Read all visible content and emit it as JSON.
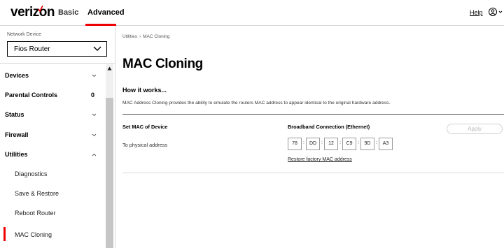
{
  "header": {
    "logo": "verizon",
    "tabs": [
      {
        "label": "Basic",
        "active": false
      },
      {
        "label": "Advanced",
        "active": true
      }
    ],
    "help_label": "Help",
    "user_icon": "user-circle-icon",
    "accent_color": "#ee0000"
  },
  "sidebar": {
    "network_device_label": "Network Device",
    "network_device_value": "Fios Router",
    "items": [
      {
        "label": "Devices",
        "trail": "chevron-down"
      },
      {
        "label": "Parental Controls",
        "trail": "0"
      },
      {
        "label": "Status",
        "trail": "chevron-down"
      },
      {
        "label": "Firewall",
        "trail": "chevron-down"
      },
      {
        "label": "Utilities",
        "trail": "chevron-up"
      },
      {
        "label": "Diagnostics"
      },
      {
        "label": "Save & Restore"
      },
      {
        "label": "Reboot Router"
      },
      {
        "label": "MAC Cloning",
        "active": true
      }
    ]
  },
  "main": {
    "breadcrumb": {
      "parent": "Utilities",
      "separator": "›",
      "current": "MAC Cloning"
    },
    "title": "MAC Cloning",
    "how_title": "How it works...",
    "how_desc": "MAC Address Cloning provides the ability to emulate the routers MAC address to appear identical to the original hardware address.",
    "col_header_left": "Set MAC of Device",
    "col_header_right": "Broadband Connection (Ethernet)",
    "apply_label": "Apply",
    "row_label": "To physical address",
    "mac_octets": [
      "78",
      "DD",
      "12",
      "C9",
      "9D",
      "A3"
    ],
    "mac_separator": ":",
    "restore_link": "Restore factory MAC address"
  }
}
